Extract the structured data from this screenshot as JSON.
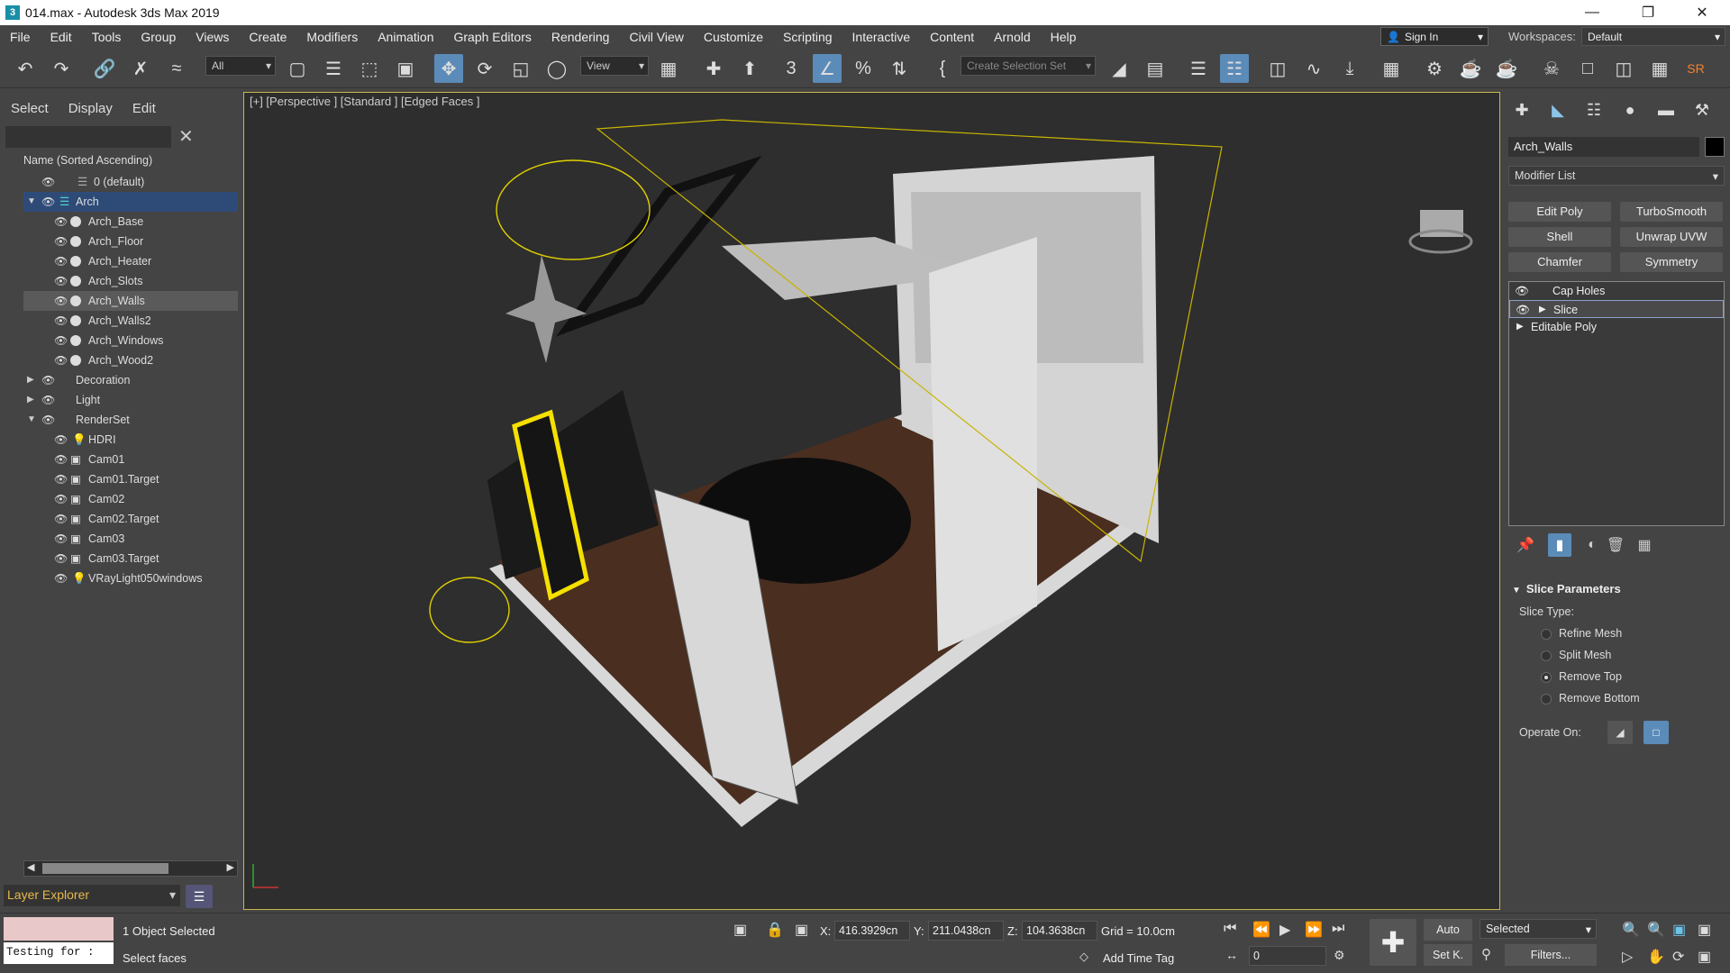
{
  "window": {
    "title": "014.max - Autodesk 3ds Max 2019",
    "app_icon": "3"
  },
  "menu": [
    "File",
    "Edit",
    "Tools",
    "Group",
    "Views",
    "Create",
    "Modifiers",
    "Animation",
    "Graph Editors",
    "Rendering",
    "Civil View",
    "Customize",
    "Scripting",
    "Interactive",
    "Content",
    "Arnold",
    "Help"
  ],
  "account": {
    "sign_in": "Sign In",
    "workspaces_label": "Workspaces:",
    "workspace": "Default"
  },
  "toolbar": {
    "filter": "All",
    "ref_coord": "View",
    "selection_set_placeholder": "Create Selection Set"
  },
  "scene_explorer": {
    "tabs": [
      "Select",
      "Display",
      "Edit"
    ],
    "column_header": "Name (Sorted Ascending)",
    "rows": [
      {
        "label": "0 (default)",
        "level": 0
      },
      {
        "label": "Arch",
        "level": 0
      },
      {
        "label": "Arch_Base",
        "level": 1
      },
      {
        "label": "Arch_Floor",
        "level": 1
      },
      {
        "label": "Arch_Heater",
        "level": 1
      },
      {
        "label": "Arch_Slots",
        "level": 1
      },
      {
        "label": "Arch_Walls",
        "level": 1
      },
      {
        "label": "Arch_Walls2",
        "level": 1
      },
      {
        "label": "Arch_Windows",
        "level": 1
      },
      {
        "label": "Arch_Wood2",
        "level": 1
      },
      {
        "label": "Decoration",
        "level": 0
      },
      {
        "label": "Light",
        "level": 0
      },
      {
        "label": "RenderSet",
        "level": 0
      },
      {
        "label": "HDRI",
        "level": 1
      },
      {
        "label": "Cam01",
        "level": 1
      },
      {
        "label": "Cam01.Target",
        "level": 1
      },
      {
        "label": "Cam02",
        "level": 1
      },
      {
        "label": "Cam02.Target",
        "level": 1
      },
      {
        "label": "Cam03",
        "level": 1
      },
      {
        "label": "Cam03.Target",
        "level": 1
      },
      {
        "label": "VRayLight050windows",
        "level": 1
      }
    ],
    "layer_explorer": "Layer Explorer"
  },
  "viewport": {
    "label": "[+] [Perspective ] [Standard ] [Edged Faces ]"
  },
  "command_panel": {
    "object_name": "Arch_Walls",
    "modifier_list": "Modifier List",
    "modifier_buttons": [
      "Edit Poly",
      "TurboSmooth",
      "Shell",
      "Unwrap UVW",
      "Chamfer",
      "Symmetry"
    ],
    "stack": [
      "Cap Holes",
      "Slice",
      "Editable Poly"
    ],
    "rollout_title": "Slice Parameters",
    "slice_type_label": "Slice Type:",
    "slice_options": [
      "Refine Mesh",
      "Split Mesh",
      "Remove Top",
      "Remove Bottom"
    ],
    "selected_option": "Remove Top",
    "operate_on_label": "Operate On:"
  },
  "status": {
    "maxscript_input": "Testing for :",
    "selection": "1 Object Selected",
    "prompt": "Select faces",
    "x": "416.3929cn",
    "y": "211.0438cn",
    "z": "104.3638cn",
    "grid": "Grid = 10.0cm",
    "add_time_tag": "Add Time Tag",
    "frame": "0",
    "auto": "Auto",
    "set_key": "Set K.",
    "key_filter": "Selected",
    "filters": "Filters..."
  }
}
